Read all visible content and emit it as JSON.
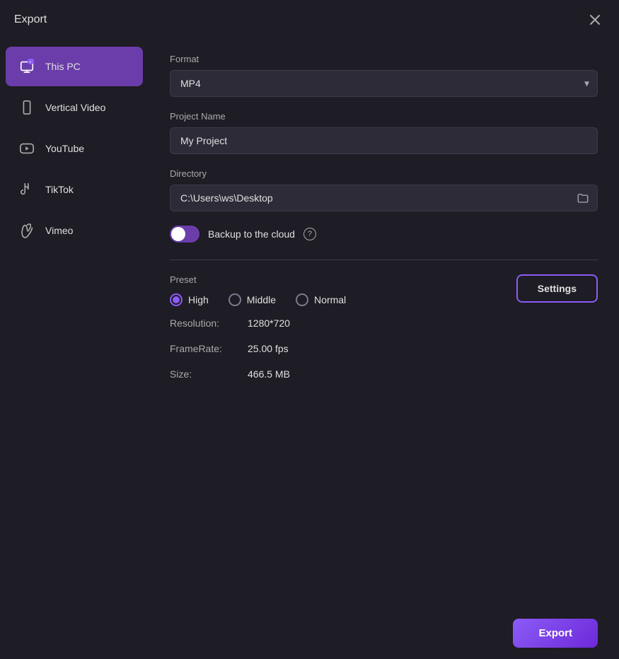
{
  "titleBar": {
    "title": "Export",
    "closeLabel": "×"
  },
  "sidebar": {
    "items": [
      {
        "id": "this-pc",
        "label": "This PC",
        "active": true
      },
      {
        "id": "vertical-video",
        "label": "Vertical Video",
        "active": false
      },
      {
        "id": "youtube",
        "label": "YouTube",
        "active": false
      },
      {
        "id": "tiktok",
        "label": "TikTok",
        "active": false
      },
      {
        "id": "vimeo",
        "label": "Vimeo",
        "active": false
      }
    ]
  },
  "form": {
    "formatLabel": "Format",
    "formatValue": "MP4",
    "projectNameLabel": "Project Name",
    "projectNameValue": "My Project",
    "directoryLabel": "Directory",
    "directoryValue": "C:\\Users\\ws\\Desktop",
    "backupLabel": "Backup to the cloud",
    "backupEnabled": true
  },
  "preset": {
    "label": "Preset",
    "options": [
      {
        "id": "high",
        "label": "High",
        "selected": true
      },
      {
        "id": "middle",
        "label": "Middle",
        "selected": false
      },
      {
        "id": "normal",
        "label": "Normal",
        "selected": false
      }
    ],
    "settingsButtonLabel": "Settings"
  },
  "specs": {
    "resolutionLabel": "Resolution:",
    "resolutionValue": "1280*720",
    "frameRateLabel": "FrameRate:",
    "frameRateValue": "25.00 fps",
    "sizeLabel": "Size:",
    "sizeValue": "466.5 MB"
  },
  "footer": {
    "exportButtonLabel": "Export"
  }
}
